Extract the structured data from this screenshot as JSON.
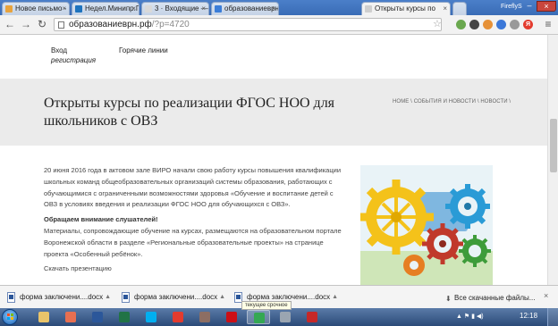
{
  "browser": {
    "tabs": [
      {
        "label": "Новое письмо - поч",
        "color": "#e8a33d"
      },
      {
        "label": "Недел.Минипр.Пси",
        "color": "#1e73be"
      },
      {
        "label": "3 · Входящие — Ян",
        "color": "#d9d9d9"
      },
      {
        "label": "образованиеврн.р",
        "color": "#3b7dd8"
      },
      {
        "label": "Открыты курсы по",
        "color": "#cfcfcf",
        "active": true
      }
    ],
    "profile": "FireflyS",
    "url_host": "образованиеврн.рф",
    "url_path": "/?p=4720",
    "extensions": [
      {
        "name": "ext-1",
        "color": "#6aa84f",
        "glyph": "●"
      },
      {
        "name": "ext-2",
        "color": "#444444",
        "glyph": "●"
      },
      {
        "name": "ext-3",
        "color": "#e69138",
        "glyph": "●"
      },
      {
        "name": "ext-4",
        "color": "#3c78d8",
        "glyph": "●"
      },
      {
        "name": "ext-5",
        "color": "#999999",
        "glyph": "●"
      },
      {
        "name": "ext-yandex",
        "color": "#e33b2e",
        "glyph": "Я"
      }
    ]
  },
  "site": {
    "nav": {
      "login": "Вход",
      "register": "регистрация",
      "hotlines": "Горячие линии"
    },
    "title": "Открыты курсы по реализации ФГОС НОО для школьников с ОВЗ",
    "breadcrumb": "HOME \\ СОБЫТИЯ И НОВОСТИ \\ НОВОСТИ \\",
    "paragraph1": "20 июня 2016 года в актовом зале ВИРО начали свою работу курсы повышения квалификации школьных команд общеобразовательных организаций системы образования, работающих с обучающимися с ограниченными возможностями здоровья «Обучение и воспитание детей с ОВЗ в условиях введения и реализации ФГОС НОО для обучающихся с ОВЗ».",
    "attention": "Обращаем внимание слушателей!",
    "paragraph2": "Материалы, сопровождающие обучение на курсах, размещаются на образовательном портале Воронежской области в разделе «Региональные образовательные проекты» на странице проекта «Особенный ребёнок».",
    "download": "Скачать презентацию"
  },
  "downloads": {
    "items": [
      {
        "name": "форма заключени....docx"
      },
      {
        "name": "форма заключени....docx"
      },
      {
        "name": "форма заключени....docx"
      }
    ],
    "tooltip": "текущее срочное",
    "all_label": "Все скачанные файлы..."
  },
  "taskbar": {
    "apps": [
      {
        "name": "explorer-app",
        "color": "#e9c46a"
      },
      {
        "name": "media-player-app",
        "color": "#e76f51"
      },
      {
        "name": "word-app",
        "color": "#2b579a"
      },
      {
        "name": "excel-app",
        "color": "#217346"
      },
      {
        "name": "skype-app",
        "color": "#00aff0"
      },
      {
        "name": "yandex-browser-app",
        "color": "#e33b2e"
      },
      {
        "name": "paint-app",
        "color": "#8d6e63"
      },
      {
        "name": "opera-app",
        "color": "#cc0f16"
      },
      {
        "name": "chrome-app",
        "color": "#34a853",
        "active": true
      },
      {
        "name": "viewer-app",
        "color": "#9aa5b1"
      },
      {
        "name": "pdf-app",
        "color": "#c62828"
      }
    ],
    "clock": "12:18"
  }
}
